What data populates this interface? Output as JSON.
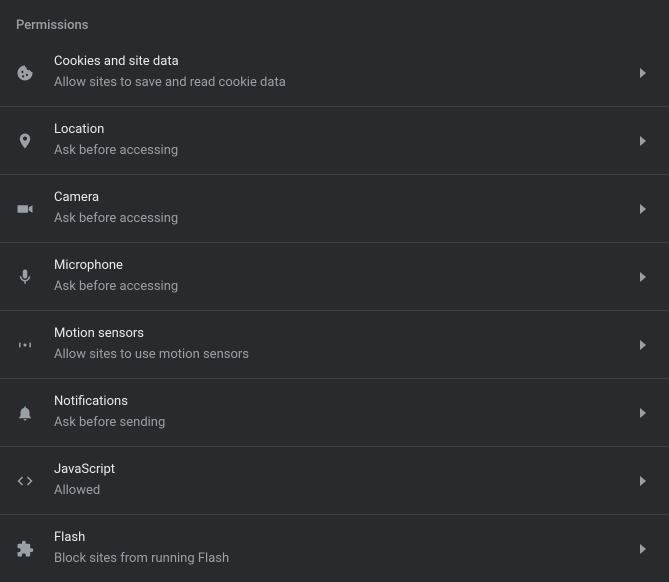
{
  "section": {
    "title": "Permissions"
  },
  "rows": [
    {
      "title": "Cookies and site data",
      "subtitle": "Allow sites to save and read cookie data"
    },
    {
      "title": "Location",
      "subtitle": "Ask before accessing"
    },
    {
      "title": "Camera",
      "subtitle": "Ask before accessing"
    },
    {
      "title": "Microphone",
      "subtitle": "Ask before accessing"
    },
    {
      "title": "Motion sensors",
      "subtitle": "Allow sites to use motion sensors"
    },
    {
      "title": "Notifications",
      "subtitle": "Ask before sending"
    },
    {
      "title": "JavaScript",
      "subtitle": "Allowed"
    },
    {
      "title": "Flash",
      "subtitle": "Block sites from running Flash"
    }
  ]
}
